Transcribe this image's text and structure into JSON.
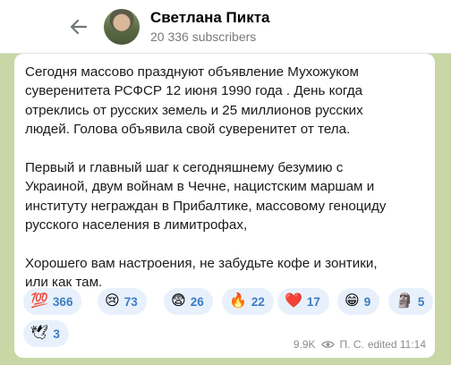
{
  "header": {
    "channel_name": "Светлана Пикта",
    "subscribers": "20 336 subscribers"
  },
  "message": {
    "text": "Сегодня массово празднуют объявление Мухожуком\nсуверенитета РСФСР 12 июня 1990 года . День когда\nотреклись от русских земель и 25 миллионов русских\nлюдей. Голова объявила свой суверенитет от тела.\n\nПервый и главный шаг к сегодняшнему безумию с\nУкраиной, двум войнам в Чечне, нацистским маршам и\nинституту неграждан в Прибалтике, массовому геноциду\nрусского населения в лимитрофах,\n\nХорошего вам настроения, не забудьте кофе и зонтики,\nили как там.",
    "views": "9.9K",
    "author": "П. С.",
    "edited_time": "edited 11:14"
  },
  "reactions": [
    {
      "emoji": "💯",
      "count": "366"
    },
    {
      "emoji": "😢",
      "count": "73"
    },
    {
      "emoji": "😨",
      "count": "26"
    },
    {
      "emoji": "🔥",
      "count": "22"
    },
    {
      "emoji": "❤️",
      "count": "17"
    },
    {
      "emoji": "😁",
      "count": "9"
    },
    {
      "emoji": "🗿",
      "count": "5"
    },
    {
      "emoji": "🕊",
      "count": "3"
    }
  ],
  "colors": {
    "background": "#c8d7a5",
    "accent": "#3b7cc4",
    "reaction_bg": "#e8f1fb"
  }
}
